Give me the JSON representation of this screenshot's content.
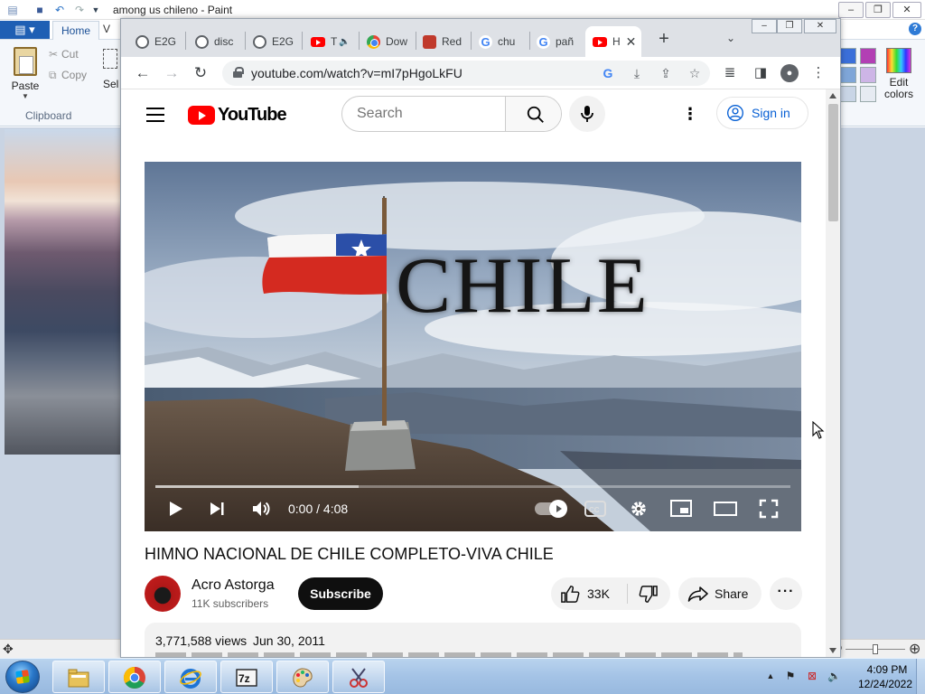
{
  "paint": {
    "title": "among us chileno - Paint",
    "tabs": {
      "home": "Home",
      "view": "V"
    },
    "clipboard": {
      "paste": "Paste",
      "cut": "Cut",
      "copy": "Copy",
      "group_label": "Clipboard"
    },
    "select_label": "Sel",
    "edit_colors": "Edit colors",
    "swatches": [
      "#3b6fd9",
      "#b23fb4",
      "#7fa6d8",
      "#cdb5e6",
      "#c9d5e6",
      "#e6ebf2"
    ]
  },
  "browser": {
    "tabs": [
      {
        "label": "E2G",
        "favicon": "globe-icon"
      },
      {
        "label": "disc",
        "favicon": "globe-icon"
      },
      {
        "label": "E2G",
        "favicon": "globe-icon"
      },
      {
        "label": "T",
        "favicon": "youtube-icon",
        "audio": true
      },
      {
        "label": "Dow",
        "favicon": "chromium-icon"
      },
      {
        "label": "Red",
        "favicon": "game-icon"
      },
      {
        "label": "chu",
        "favicon": "google-icon"
      },
      {
        "label": "pañ",
        "favicon": "google-icon"
      },
      {
        "label": "H",
        "favicon": "youtube-icon",
        "active": true
      }
    ],
    "url": "youtube.com/watch?v=mI7pHgoLkFU",
    "new_tab_symbol": "+"
  },
  "youtube": {
    "logo_text": "YouTube",
    "search_placeholder": "Search",
    "sign_in": "Sign in",
    "video": {
      "overlay_word": "CHILE",
      "time": "0:00 / 4:08",
      "progress_loaded_fraction": 0.32,
      "title": "HIMNO NACIONAL DE CHILE COMPLETO-VIVA CHILE"
    },
    "channel": {
      "name": "Acro Astorga",
      "subscribers": "11K subscribers",
      "subscribe": "Subscribe"
    },
    "actions": {
      "likes": "33K",
      "share": "Share"
    },
    "description": {
      "views": "3,771,588 views",
      "date": "Jun 30, 2011"
    }
  },
  "taskbar": {
    "apps": [
      "file-explorer",
      "chrome",
      "internet-explorer",
      "7-zip",
      "paint",
      "snipping-tool"
    ],
    "clock": {
      "time": "4:09 PM",
      "date": "12/24/2022"
    }
  }
}
